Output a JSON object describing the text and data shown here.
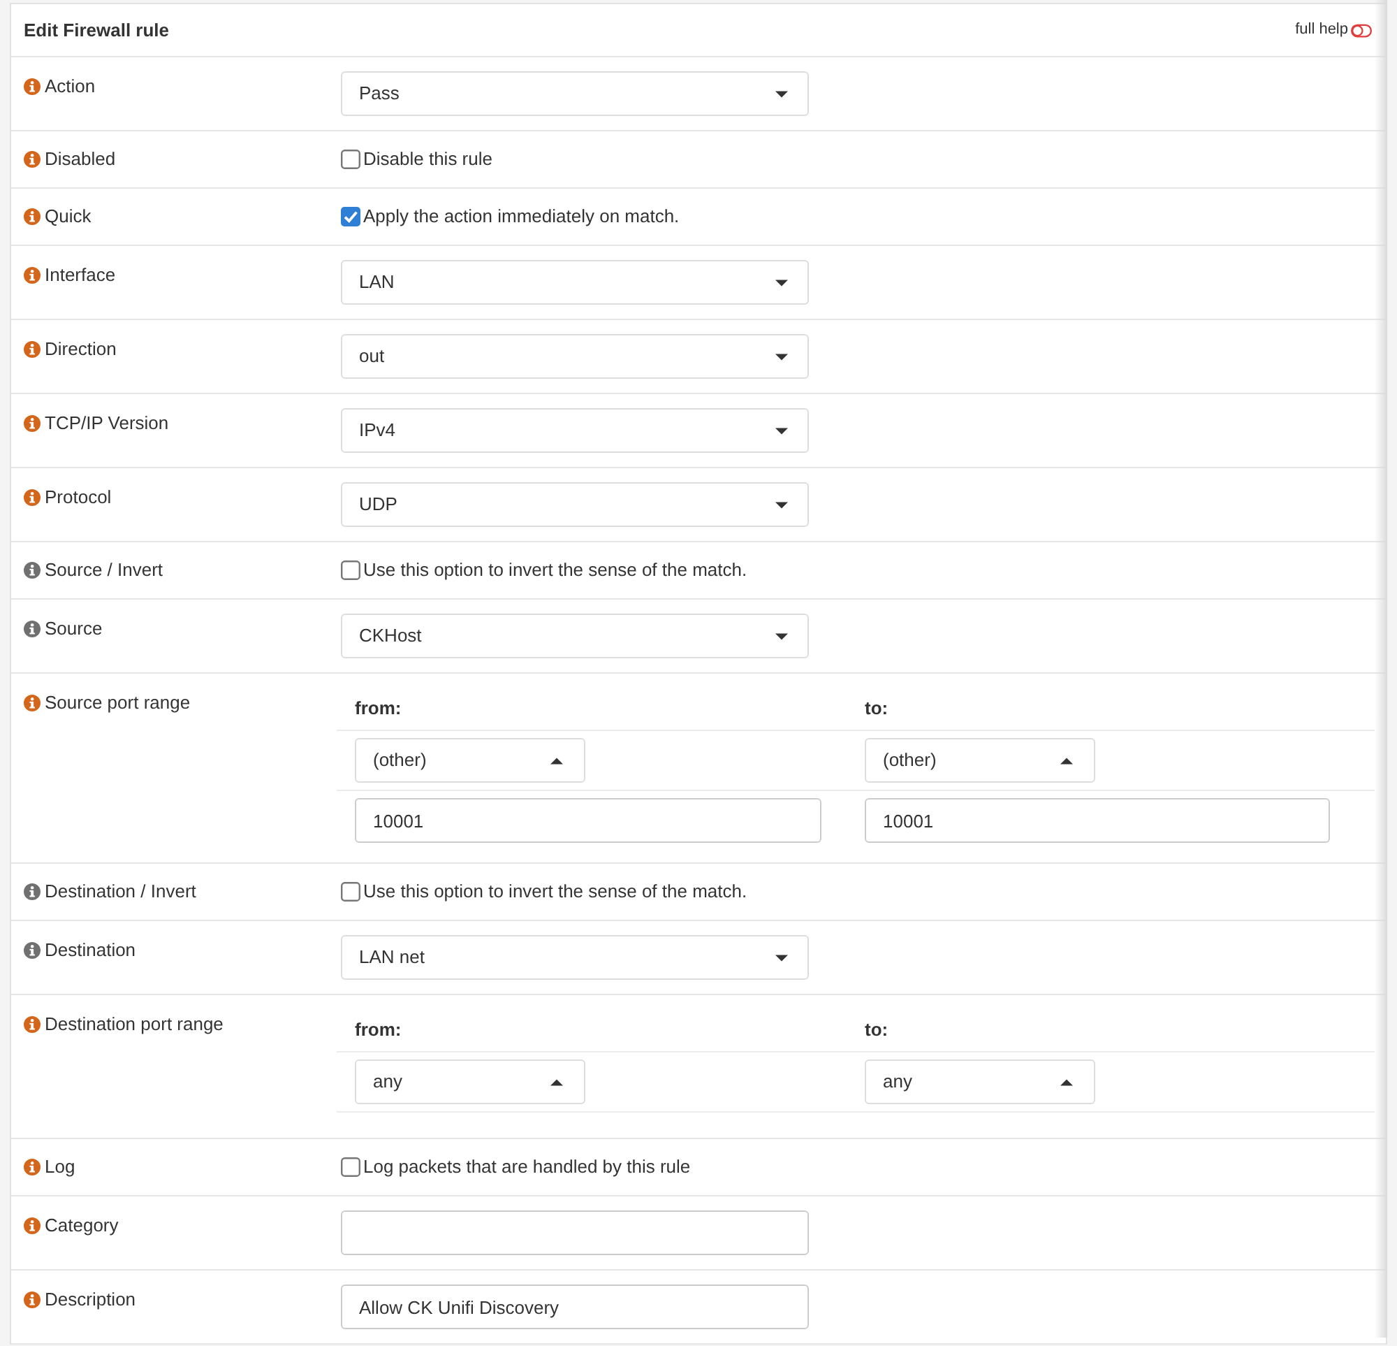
{
  "panel": {
    "title": "Edit Firewall rule",
    "full_help": {
      "label": "full help",
      "on": false
    }
  },
  "rows": [
    {
      "kind": "select",
      "label": "Action",
      "color": "#d4661c",
      "value": "Pass"
    },
    {
      "kind": "checkbox",
      "label": "Disabled",
      "color": "#d4661c",
      "text": "Disable this rule",
      "checked": false
    },
    {
      "kind": "checkbox",
      "label": "Quick",
      "color": "#d4661c",
      "text": "Apply the action immediately on match.",
      "checked": true
    },
    {
      "kind": "select",
      "label": "Interface",
      "color": "#d4661c",
      "value": "LAN"
    },
    {
      "kind": "select",
      "label": "Direction",
      "color": "#d4661c",
      "value": "out"
    },
    {
      "kind": "select",
      "label": "TCP/IP Version",
      "color": "#d4661c",
      "value": "IPv4"
    },
    {
      "kind": "select",
      "label": "Protocol",
      "color": "#d4661c",
      "value": "UDP"
    },
    {
      "kind": "checkbox",
      "label": "Source / Invert",
      "color": "#707070",
      "text": "Use this option to invert the sense of the match.",
      "checked": false
    },
    {
      "kind": "select",
      "label": "Source",
      "color": "#707070",
      "value": "CKHost"
    },
    {
      "kind": "port_range",
      "label": "Source port range",
      "color": "#d4661c",
      "from": {
        "heading": "from:",
        "option": "(other)",
        "value": "10001"
      },
      "to": {
        "heading": "to:",
        "option": "(other)",
        "value": "10001"
      }
    },
    {
      "kind": "checkbox",
      "label": "Destination / Invert",
      "color": "#707070",
      "text": "Use this option to invert the sense of the match.",
      "checked": false
    },
    {
      "kind": "select",
      "label": "Destination",
      "color": "#707070",
      "value": "LAN net"
    },
    {
      "kind": "port_range",
      "label": "Destination port range",
      "color": "#d4661c",
      "from": {
        "heading": "from:",
        "option": "any"
      },
      "to": {
        "heading": "to:",
        "option": "any"
      }
    },
    {
      "kind": "checkbox",
      "label": "Log",
      "color": "#d4661c",
      "text": "Log packets that are handled by this rule",
      "checked": false
    },
    {
      "kind": "input",
      "label": "Category",
      "color": "#d4661c"
    },
    {
      "kind": "input",
      "label": "Description",
      "color": "#d4661c",
      "value": "Allow CK Unifi Discovery"
    }
  ]
}
